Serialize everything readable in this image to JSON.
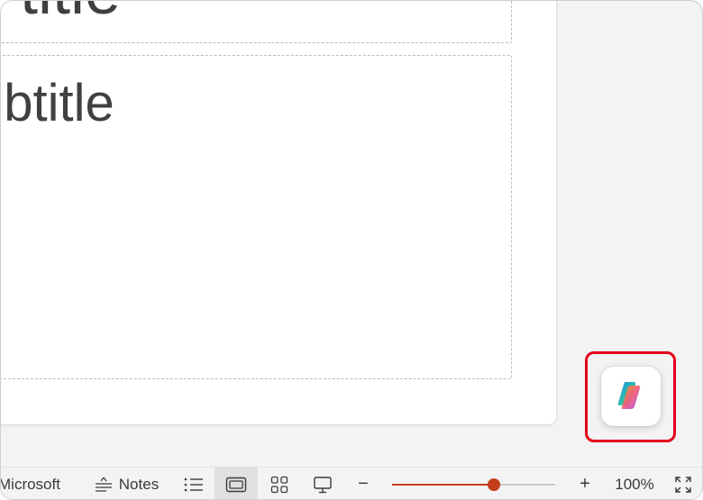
{
  "slide": {
    "title_text": "d title",
    "subtitle_text": "ubtitle"
  },
  "copilot": {
    "icon": "copilot-icon",
    "highlight_color": "#e5001a"
  },
  "statusbar": {
    "language_text": "Microsoft",
    "notes_label": "Notes",
    "notes_icon": "notes-icon",
    "outline_view_icon": "list-icon",
    "normal_view_icon": "normal-view-icon",
    "slide_sorter_icon": "grid-icon",
    "presenter_view_icon": "presentation-icon",
    "zoom_out_label": "−",
    "zoom_in_label": "+",
    "zoom_value": 100,
    "zoom_label": "100%",
    "fit_icon": "fit-to-window-icon",
    "accent_color": "#c43e1c"
  }
}
